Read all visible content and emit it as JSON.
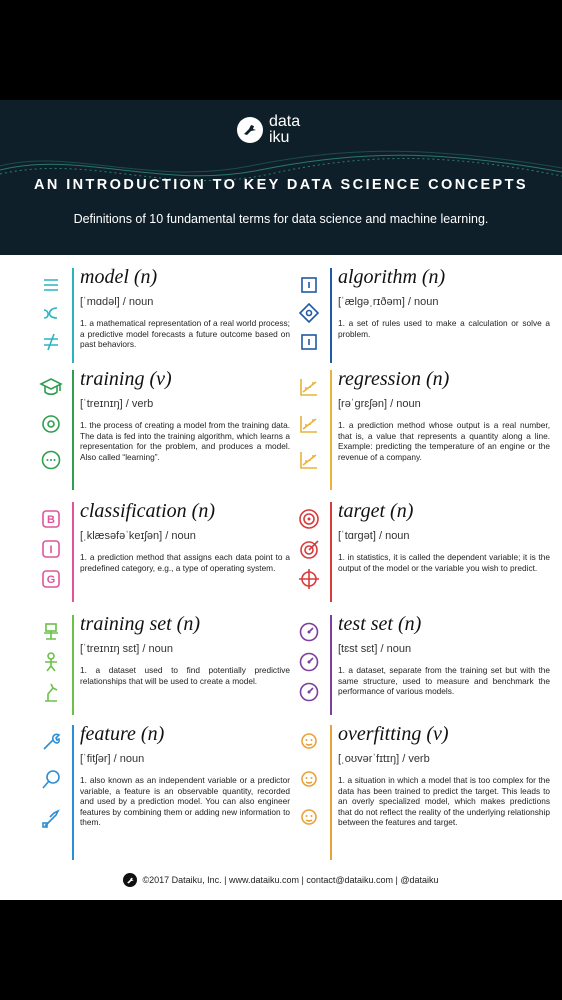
{
  "header": {
    "logo_line1": "data",
    "logo_line2": "iku",
    "title": "AN INTRODUCTION TO KEY DATA SCIENCE CONCEPTS",
    "subtitle": "Definitions of 10 fundamental terms for data science and machine learning."
  },
  "entries": [
    {
      "term": "model (n)",
      "pron": "[ˈmɑdəl]  /  noun",
      "def": "1. a mathematical representation of a real world process; a predictive model forecasts a future outcome based on past behaviors.",
      "color": "#2bb3c0",
      "icons": [
        "equal-icon",
        "proportional-icon",
        "not-equal-icon"
      ]
    },
    {
      "term": "algorithm (n)",
      "pron": "[ˈælgəˌrɪðəm]  /  noun",
      "def": "1. a set of rules used to make a calculation or solve a problem.",
      "color": "#1f5aa6",
      "icons": [
        "flowchart-box-icon",
        "decision-diamond-icon",
        "flowchart-box-icon"
      ]
    },
    {
      "term": "training (v)",
      "pron": "[ˈtreɪnɪŋ]  /  verb",
      "def": "1. the process of creating a model from the training data. The data is fed into the training algorithm, which learns a representation for the problem, and produces a model. Also called “learning”.",
      "color": "#2e9e4f",
      "icons": [
        "graduation-cap-icon",
        "brain-gear-icon",
        "chat-bubble-icon"
      ]
    },
    {
      "term": "regression (n)",
      "pron": "[rəˈgrɛʃən]  /  noun",
      "def": "1. a prediction method whose output is a real number, that is, a value that represents a quantity along a line. Example: predicting the temperature of an engine or the revenue of a company.",
      "color": "#e8b43a",
      "icons": [
        "scatter-plot-icon",
        "scatter-plot-icon",
        "scatter-plot-icon"
      ]
    },
    {
      "term": "classification (n)",
      "pron": "[ˌklæsəfəˈkeɪʃən]  /  noun",
      "def": "1. a prediction method that assigns each data point to a predefined category, e.g., a type of operating system.",
      "color": "#e0559a",
      "icons": [
        "category-b-icon",
        "category-i-icon",
        "category-g-icon"
      ],
      "letters": [
        "B",
        "I",
        "G"
      ]
    },
    {
      "term": "target (n)",
      "pron": "[ˈtɑrgət]  /  noun",
      "def": "1. in statistics, it is called the dependent variable; it is the output of the model or the variable you wish to predict.",
      "color": "#d93a3a",
      "icons": [
        "target-icon",
        "target-arrow-icon",
        "crosshair-icon"
      ]
    },
    {
      "term": "training set (n)",
      "pron": "[ˈtreɪnɪŋ sɛt]  /  noun",
      "def": "1. a dataset used to find potentially predictive relationships that will be used to create a model.",
      "color": "#6cc04a",
      "icons": [
        "robot-icon",
        "person-icon",
        "robot-arm-icon"
      ]
    },
    {
      "term": "test set (n)",
      "pron": "[tɛst sɛt]  /  noun",
      "def": "1. a dataset, separate from the training set but with the same structure, used to measure and benchmark the performance of various models.",
      "color": "#7b3fa0",
      "icons": [
        "gauge-icon",
        "gauge-icon",
        "gauge-icon"
      ]
    },
    {
      "term": "feature (n)",
      "pron": "[ˈfitʃər]  /  noun",
      "def": "1. also known as an independent variable or a predictor variable, a feature is an observable quantity, recorded and used by a prediction model. You can also engineer features by combining them or adding new information to them.",
      "color": "#2a8fd6",
      "icons": [
        "wrench-icon",
        "magnifier-icon",
        "screwdriver-icon"
      ]
    },
    {
      "term": "overfitting (v)",
      "pron": "[ˌoʊvərˈfɪtɪŋ]  /  verb",
      "def": "1. a situation in which a model that is too complex for the data has been trained to predict the target. This leads to an overly specialized model, which makes predictions that do not reflect the reality of the underlying relationship between the features and target.",
      "color": "#e8a23a",
      "icons": [
        "see-no-evil-monkey-icon",
        "hear-no-evil-monkey-icon",
        "speak-no-evil-monkey-icon"
      ]
    }
  ],
  "footer": {
    "text": "©2017 Dataiku, Inc. | www.dataiku.com | contact@dataiku.com | @dataiku"
  }
}
